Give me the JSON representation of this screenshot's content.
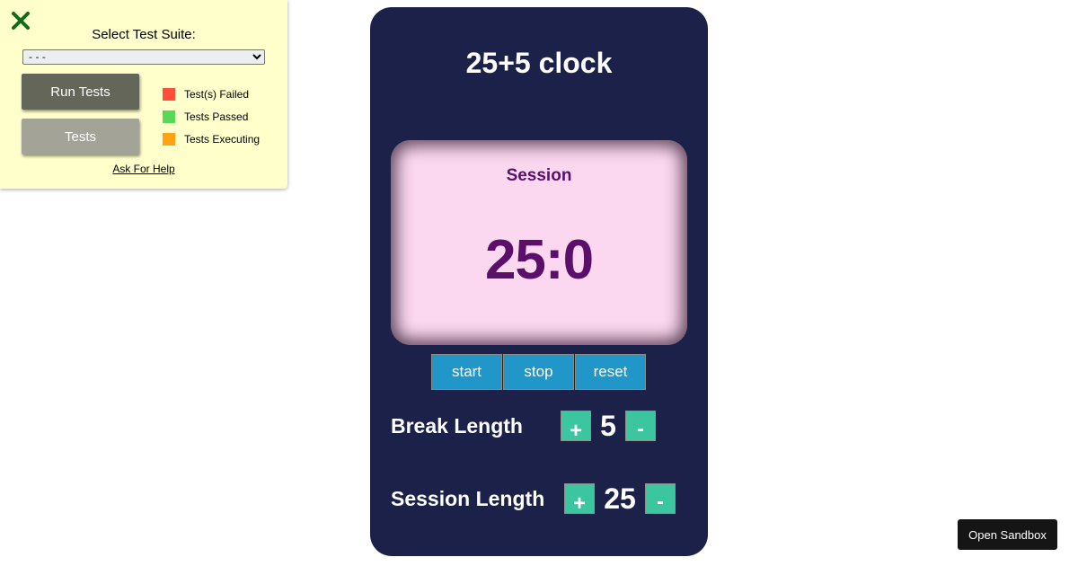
{
  "test_panel": {
    "close_icon": "close-icon",
    "suite_title": "Select Test Suite:",
    "suite_selected": "- - -",
    "run_button": "Run Tests",
    "tests_button": "Tests",
    "legend": [
      {
        "label": "Test(s) Failed",
        "color": "#ff4e3b"
      },
      {
        "label": "Tests Passed",
        "color": "#58d858"
      },
      {
        "label": "Tests Executing",
        "color": "#ffa215"
      }
    ],
    "help_link": "Ask For Help"
  },
  "clock": {
    "title": "25+5 clock",
    "timer_label": "Session",
    "time_left": "25:0",
    "start": "start",
    "stop": "stop",
    "reset": "reset",
    "break_label": "Break Length",
    "break_value": "5",
    "session_label": "Session Length",
    "session_value": "25",
    "increment": "+",
    "decrement": "-"
  },
  "sandbox_button": "Open Sandbox",
  "colors": {
    "app_bg": "#1c2149",
    "timer_bg": "#fcd7f0",
    "timer_text": "#5a0f6b",
    "control_button": "#2196c8",
    "stepper_button": "#3cc6a0"
  }
}
